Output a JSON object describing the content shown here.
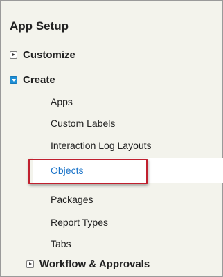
{
  "app_setup": {
    "title": "App Setup",
    "customize": {
      "label": "Customize",
      "state": "collapsed"
    },
    "create": {
      "label": "Create",
      "state": "expanded",
      "children": [
        {
          "label": "Apps"
        },
        {
          "label": "Custom Labels"
        },
        {
          "label": "Interaction Log Layouts"
        },
        {
          "label": "Objects",
          "selected": true
        },
        {
          "label": "Packages"
        },
        {
          "label": "Report Types"
        },
        {
          "label": "Tabs"
        }
      ]
    },
    "workflow": {
      "label": "Workflow & Approvals",
      "state": "collapsed"
    }
  },
  "colors": {
    "panel_background": "#f3f3ec",
    "selected_link": "#1a73c8",
    "expanded_toggle": "#1f8fd6",
    "highlight_border": "#c0202e"
  }
}
